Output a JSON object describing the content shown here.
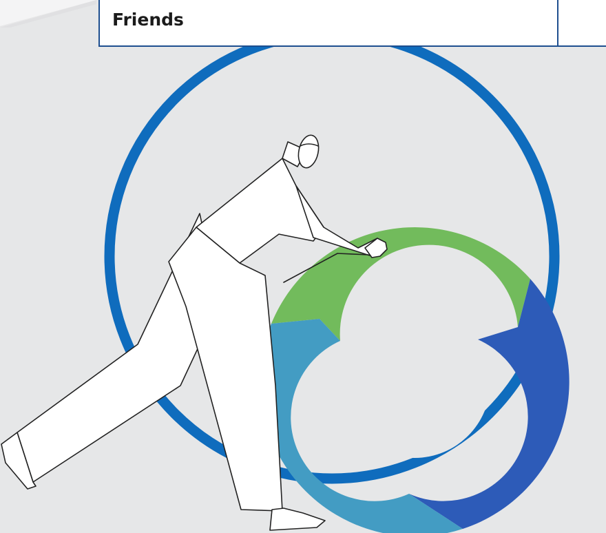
{
  "table": {
    "header_label": "Friends"
  },
  "colors": {
    "background": "#e6e7e8",
    "ring": "#0f6cbd",
    "cycle_green": "#72bb5c",
    "cycle_dark_blue": "#2d5bb8",
    "cycle_light_blue": "#439cc3",
    "table_border": "#1d4e8f"
  },
  "icons": {
    "illustration": "person-pushing-cycle-icon"
  }
}
